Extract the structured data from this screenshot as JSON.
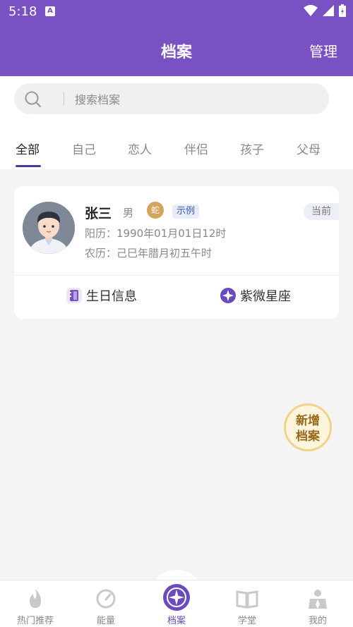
{
  "status": {
    "time": "5:18",
    "badge": "A"
  },
  "header": {
    "title": "档案",
    "manage_label": "管理"
  },
  "search": {
    "placeholder": "搜索档案"
  },
  "tabs": [
    {
      "label": "全部",
      "active": true
    },
    {
      "label": "自己"
    },
    {
      "label": "恋人"
    },
    {
      "label": "伴侣"
    },
    {
      "label": "孩子"
    },
    {
      "label": "父母"
    }
  ],
  "profile": {
    "name": "张三",
    "gender": "男",
    "zodiac_glyph": "蛇",
    "example_tag": "示例",
    "current_tag": "当前",
    "solar": "阳历：1990年01月01日12时",
    "lunar": "农历：己巳年腊月初五午时",
    "action_birthday": "生日信息",
    "action_ziwei": "紫微星座"
  },
  "fab": {
    "line1": "新增",
    "line2": "档案"
  },
  "nav": [
    {
      "label": "热门推荐",
      "icon": "flame-icon"
    },
    {
      "label": "能量",
      "icon": "gauge-icon"
    },
    {
      "label": "档案",
      "icon": "compass-icon",
      "active": true
    },
    {
      "label": "学堂",
      "icon": "book-icon"
    },
    {
      "label": "我的",
      "icon": "profile-icon"
    }
  ],
  "colors": {
    "primary": "#7a51c2",
    "accent": "#6a4bbd",
    "fab_border": "#efd38a"
  }
}
